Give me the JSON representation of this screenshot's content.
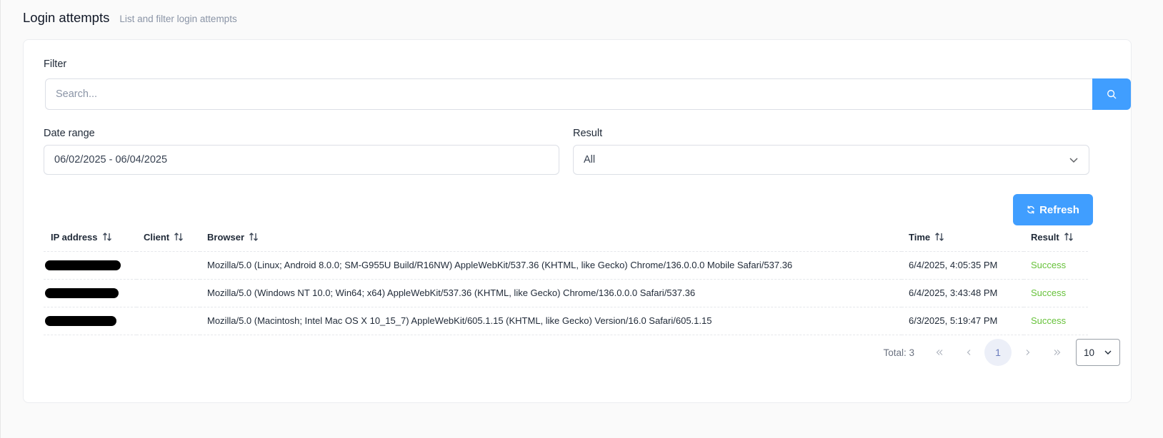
{
  "header": {
    "title": "Login attempts",
    "subtitle": "List and filter login attempts"
  },
  "filter": {
    "label": "Filter",
    "search_placeholder": "Search...",
    "search_value": ""
  },
  "date_range": {
    "label": "Date range",
    "value": "06/02/2025 - 06/04/2025"
  },
  "result_filter": {
    "label": "Result",
    "value": "All"
  },
  "refresh_label": "Refresh",
  "table": {
    "columns": [
      "IP address",
      "Client",
      "Browser",
      "Time",
      "Result"
    ],
    "rows": [
      {
        "ip": "",
        "client": "",
        "browser": "Mozilla/5.0 (Linux; Android 8.0.0; SM-G955U Build/R16NW) AppleWebKit/537.36 (KHTML, like Gecko) Chrome/136.0.0.0 Mobile Safari/537.36",
        "time": "6/4/2025, 4:05:35 PM",
        "result": "Success"
      },
      {
        "ip": "",
        "client": "",
        "browser": "Mozilla/5.0 (Windows NT 10.0; Win64; x64) AppleWebKit/537.36 (KHTML, like Gecko) Chrome/136.0.0.0 Safari/537.36",
        "time": "6/4/2025, 3:43:48 PM",
        "result": "Success"
      },
      {
        "ip": "",
        "client": "",
        "browser": "Mozilla/5.0 (Macintosh; Intel Mac OS X 10_15_7) AppleWebKit/605.1.15 (KHTML, like Gecko) Version/16.0 Safari/605.1.15",
        "time": "6/3/2025, 5:19:47 PM",
        "result": "Success"
      }
    ]
  },
  "pagination": {
    "total_label": "Total: 3",
    "current_page": "1",
    "page_size": "10"
  },
  "colors": {
    "accent": "#409eff",
    "success": "#67c23a"
  },
  "icons": {
    "search": "search-icon",
    "refresh": "refresh-icon",
    "sort": "sort-icon",
    "chevron": "chevron-down-icon"
  }
}
